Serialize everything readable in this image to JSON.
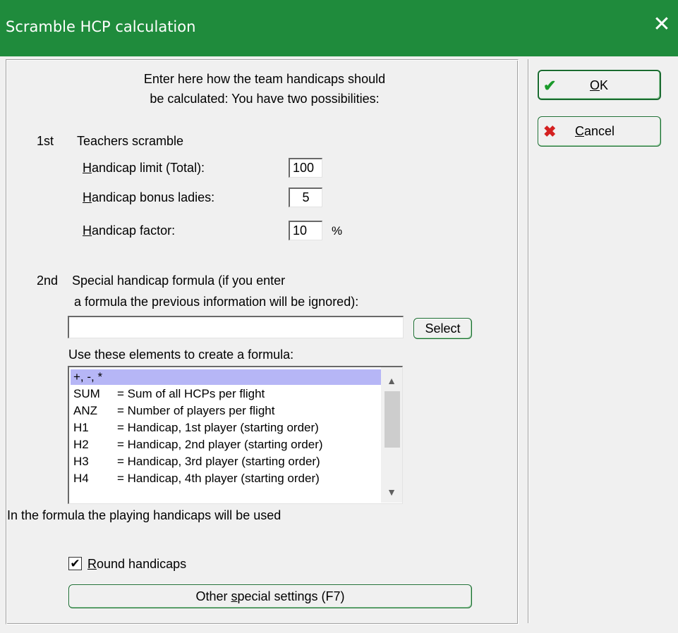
{
  "window": {
    "title": "Scramble HCP calculation",
    "close_glyph": "✕"
  },
  "intro": {
    "line1": "Enter here  how the team handicaps should",
    "line2": "be calculated: You have two possibilities:"
  },
  "first": {
    "num": "1st",
    "heading": "Teachers scramble",
    "limit_label_first": "H",
    "limit_label_rest": "andicap limit (Total):",
    "limit_value": "100",
    "bonus_label_first": "H",
    "bonus_label_rest": "andicap bonus ladies:",
    "bonus_value": "5",
    "factor_label_first": "H",
    "factor_label_rest": "andicap factor:",
    "factor_value": "10",
    "factor_unit": "%"
  },
  "second": {
    "num": "2nd",
    "line1": "Special handicap formula (if you enter",
    "line2": "a formula the previous information will be ignored):",
    "formula_value": "",
    "select_label": "Select",
    "elements_label": "Use these elements to create a formula:"
  },
  "elements": [
    {
      "code": "+, -, *",
      "desc": ""
    },
    {
      "code": "SUM",
      "desc": "= Sum of all HCPs per flight"
    },
    {
      "code": "ANZ",
      "desc": "= Number of players per flight"
    },
    {
      "code": "H1",
      "desc": "= Handicap, 1st player (starting order)"
    },
    {
      "code": "H2",
      "desc": "= Handicap, 2nd player (starting order)"
    },
    {
      "code": "H3",
      "desc": "= Handicap, 3rd player (starting order)"
    },
    {
      "code": "H4",
      "desc": "= Handicap, 4th player (starting order)"
    }
  ],
  "note": "In the formula the playing handicaps will be used",
  "round": {
    "label_first": "R",
    "label_rest": "ound handicaps",
    "checked": true,
    "check_glyph": "✔"
  },
  "other_settings": {
    "label_pre": "Other ",
    "label_u": "s",
    "label_post": "pecial settings (F7)"
  },
  "ok": {
    "label_u": "O",
    "label_rest": "K",
    "icon": "✔"
  },
  "cancel": {
    "label_u": "C",
    "label_rest": "ancel",
    "icon": "✖"
  },
  "scroll": {
    "up": "▲",
    "down": "▼"
  }
}
